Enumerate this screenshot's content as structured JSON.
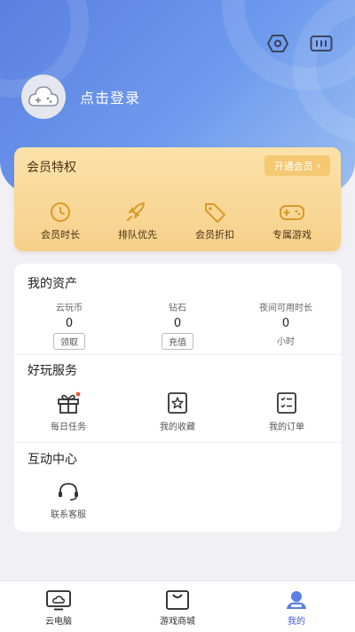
{
  "header": {
    "login_text": "点击登录",
    "icons": [
      "eye-icon",
      "settings-icon",
      "cloud-gamepad-avatar-icon"
    ]
  },
  "vip": {
    "title": "会员特权",
    "open_button": "开通会员",
    "items": [
      {
        "label": "会员时长",
        "icon": "clock-icon"
      },
      {
        "label": "排队优先",
        "icon": "rocket-icon"
      },
      {
        "label": "会员折扣",
        "icon": "tag-icon"
      },
      {
        "label": "专属游戏",
        "icon": "gamepad-icon"
      }
    ]
  },
  "assets": {
    "title": "我的资产",
    "items": [
      {
        "label": "云玩币",
        "value": "0",
        "action": "领取"
      },
      {
        "label": "钻石",
        "value": "0",
        "action": "充值"
      },
      {
        "label": "夜间可用时长",
        "value": "0",
        "unit": "小时"
      }
    ]
  },
  "services": {
    "title": "好玩服务",
    "items": [
      {
        "label": "每日任务",
        "icon": "gift-icon",
        "has_badge": true
      },
      {
        "label": "我的收藏",
        "icon": "star-icon"
      },
      {
        "label": "我的订单",
        "icon": "order-list-icon"
      }
    ]
  },
  "interaction": {
    "title": "互动中心",
    "items": [
      {
        "label": "联系客服",
        "icon": "headset-icon"
      }
    ]
  },
  "tabbar": {
    "items": [
      {
        "label": "云电脑",
        "icon": "monitor-cloud-icon",
        "active": false
      },
      {
        "label": "游戏商城",
        "icon": "shopping-bag-icon",
        "active": false
      },
      {
        "label": "我的",
        "icon": "user-icon",
        "active": true
      }
    ]
  },
  "colors": {
    "hero_start": "#5b7fe0",
    "hero_end": "#9cc0f2",
    "vip_gold": "#f6d089",
    "vip_button": "#f5c872",
    "accent_blue": "#3d5fd0",
    "badge_red": "#e8593c"
  }
}
